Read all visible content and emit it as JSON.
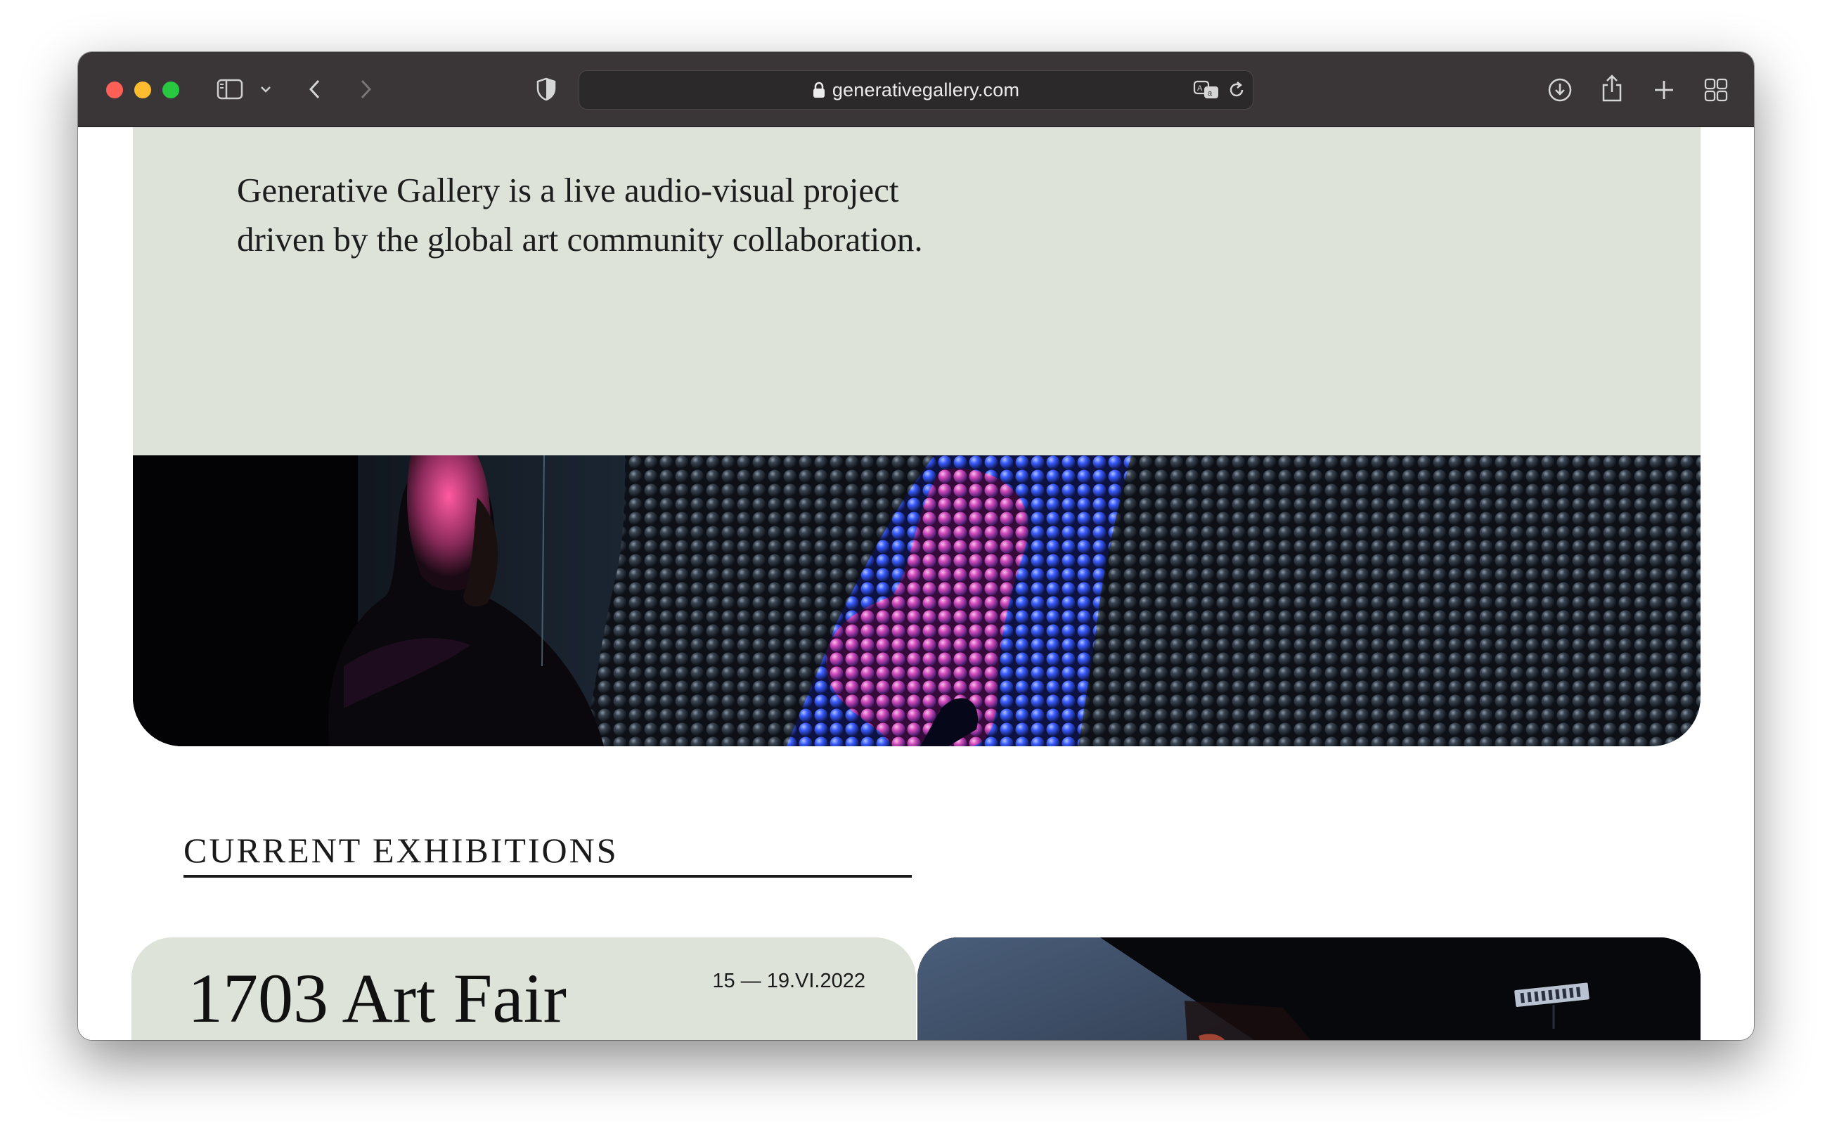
{
  "browser": {
    "url": "generativegallery.com"
  },
  "hero": {
    "tagline": "Generative Gallery is a live audio-visual project driven by the global art community collaboration."
  },
  "exhibitions": {
    "heading": "CURRENT EXHIBITIONS",
    "items": [
      {
        "title": "1703 Art Fair",
        "dates": "15 — 19.VI.2022"
      }
    ]
  },
  "colors": {
    "hero_bg": "#dde3d8",
    "toolbar_bg": "#3a3638",
    "text": "#1d1d1d"
  },
  "icons": [
    "sidebar-icon",
    "chevron-down-icon",
    "back-icon",
    "forward-icon",
    "shield-icon",
    "lock-icon",
    "translate-icon",
    "reload-icon",
    "download-icon",
    "share-icon",
    "new-tab-icon",
    "tab-overview-icon"
  ]
}
